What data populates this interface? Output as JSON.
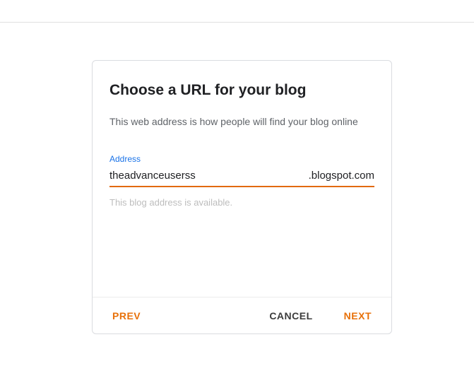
{
  "dialog": {
    "title": "Choose a URL for your blog",
    "subtitle": "This web address is how people will find your blog online",
    "field_label": "Address",
    "input_value": "theadvanceuserss",
    "suffix": ".blogspot.com",
    "availability_message": "This blog address is available."
  },
  "actions": {
    "prev": "PREV",
    "cancel": "CANCEL",
    "next": "NEXT"
  }
}
